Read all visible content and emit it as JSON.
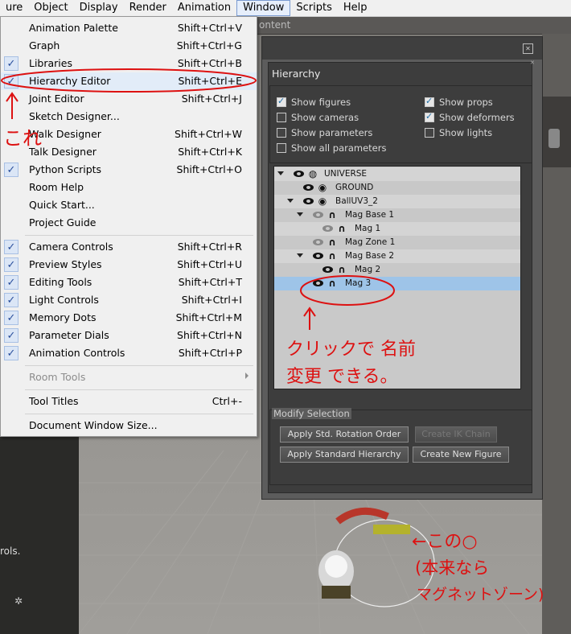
{
  "menubar": {
    "items": [
      "ure",
      "Object",
      "Display",
      "Render",
      "Animation",
      "Window",
      "Scripts",
      "Help"
    ],
    "active_index": 5
  },
  "window_menu": {
    "items": [
      {
        "label": "Animation Palette",
        "shortcut": "Shift+Ctrl+V",
        "checked": false
      },
      {
        "label": "Graph",
        "shortcut": "Shift+Ctrl+G",
        "checked": false
      },
      {
        "label": "Libraries",
        "shortcut": "Shift+Ctrl+B",
        "checked": true
      },
      {
        "label": "Hierarchy Editor",
        "shortcut": "Shift+Ctrl+E",
        "checked": true,
        "highlighted": true
      },
      {
        "label": "Joint Editor",
        "shortcut": "Shift+Ctrl+J",
        "checked": false
      },
      {
        "label": "Sketch Designer...",
        "shortcut": "",
        "checked": false
      },
      {
        "label": "Walk Designer",
        "shortcut": "Shift+Ctrl+W",
        "checked": false
      },
      {
        "label": "Talk Designer",
        "shortcut": "Shift+Ctrl+K",
        "checked": false
      },
      {
        "label": "Python Scripts",
        "shortcut": "Shift+Ctrl+O",
        "checked": true
      },
      {
        "label": "Room Help",
        "shortcut": "",
        "checked": false
      },
      {
        "label": "Quick Start...",
        "shortcut": "",
        "checked": false
      },
      {
        "label": "Project Guide",
        "shortcut": "",
        "checked": false
      },
      {
        "label": "Camera Controls",
        "shortcut": "Shift+Ctrl+R",
        "checked": true
      },
      {
        "label": "Preview Styles",
        "shortcut": "Shift+Ctrl+U",
        "checked": true
      },
      {
        "label": "Editing Tools",
        "shortcut": "Shift+Ctrl+T",
        "checked": true
      },
      {
        "label": "Light Controls",
        "shortcut": "Shift+Ctrl+I",
        "checked": true
      },
      {
        "label": "Memory Dots",
        "shortcut": "Shift+Ctrl+M",
        "checked": true
      },
      {
        "label": "Parameter Dials",
        "shortcut": "Shift+Ctrl+N",
        "checked": true
      },
      {
        "label": "Animation Controls",
        "shortcut": "Shift+Ctrl+P",
        "checked": true
      },
      {
        "label": "Room Tools",
        "shortcut": "",
        "checked": false,
        "disabled": true,
        "submenu": true
      },
      {
        "label": "Tool Titles",
        "shortcut": "Ctrl+-",
        "checked": false
      },
      {
        "label": "Document Window Size...",
        "shortcut": "",
        "checked": false
      }
    ]
  },
  "viewport": {
    "tab_text": "ontent",
    "left_text": "rols."
  },
  "hierarchy": {
    "title": "Hierarchy",
    "options": [
      {
        "label": "Show figures",
        "checked": true
      },
      {
        "label": "Show props",
        "checked": true
      },
      {
        "label": "Show cameras",
        "checked": false
      },
      {
        "label": "Show deformers",
        "checked": true
      },
      {
        "label": "Show parameters",
        "checked": false
      },
      {
        "label": "Show lights",
        "checked": false
      },
      {
        "label": "Show all parameters",
        "checked": false
      }
    ],
    "tree": [
      {
        "name": "UNIVERSE",
        "icon": "globe-icon",
        "depth": 0,
        "expanded": true,
        "eye": "on"
      },
      {
        "name": "GROUND",
        "icon": "prop-icon",
        "depth": 1,
        "expanded": null,
        "eye": "on"
      },
      {
        "name": "BallUV3_2",
        "icon": "prop-icon",
        "depth": 1,
        "expanded": true,
        "eye": "on"
      },
      {
        "name": "Mag Base 1",
        "icon": "magnet-icon",
        "depth": 2,
        "expanded": true,
        "eye": "dim"
      },
      {
        "name": "Mag 1",
        "icon": "magnet-icon",
        "depth": 3,
        "expanded": null,
        "eye": "dim"
      },
      {
        "name": "Mag Zone 1",
        "icon": "magnet-icon",
        "depth": 2,
        "expanded": null,
        "eye": "dim"
      },
      {
        "name": "Mag Base 2",
        "icon": "magnet-icon",
        "depth": 2,
        "expanded": true,
        "eye": "on"
      },
      {
        "name": "Mag 2",
        "icon": "magnet-icon",
        "depth": 3,
        "expanded": null,
        "eye": "on"
      },
      {
        "name": "Mag 3",
        "icon": "magnet-icon",
        "depth": 2,
        "expanded": null,
        "eye": "on",
        "selected": true
      }
    ],
    "modify": {
      "title": "Modify Selection",
      "buttons": [
        {
          "label": "Apply Std. Rotation Order",
          "enabled": true
        },
        {
          "label": "Create IK Chain",
          "enabled": false
        },
        {
          "label": "Apply Standard Hierarchy",
          "enabled": true
        },
        {
          "label": "Create New Figure",
          "enabled": true
        }
      ]
    }
  },
  "annotations": {
    "menu_note": "これ",
    "tree_note_line1": "クリックで 名前",
    "tree_note_line2": "変更 できる。",
    "viewport_note_line1": "←この○",
    "viewport_note_line2": "(本来なら",
    "viewport_note_line3": "マグネットゾーン)",
    "annotation_color": "#dd1111"
  },
  "colors": {
    "menu_bg": "#f0f0f0",
    "panel_bg": "#5c5c5c",
    "tree_selected": "#9ec4e8",
    "check_blue": "#2a4f9c"
  }
}
